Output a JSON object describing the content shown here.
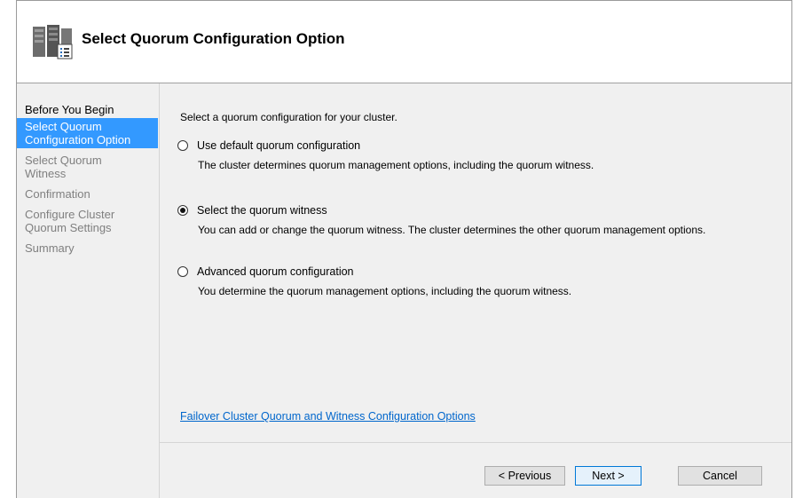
{
  "header": {
    "title": "Select Quorum Configuration Option"
  },
  "sidebar": {
    "steps": [
      {
        "label": "Before You Begin"
      },
      {
        "label": "Select Quorum Configuration Option"
      },
      {
        "label": "Select Quorum Witness"
      },
      {
        "label": "Confirmation"
      },
      {
        "label": "Configure Cluster Quorum Settings"
      },
      {
        "label": "Summary"
      }
    ]
  },
  "main": {
    "intro": "Select a quorum configuration for your cluster.",
    "options": [
      {
        "label": "Use default quorum configuration",
        "description": "The cluster determines quorum management options, including the quorum witness.",
        "checked": false
      },
      {
        "label": "Select the quorum witness",
        "description": "You can add or change the quorum witness. The cluster determines the other quorum management options.",
        "checked": true
      },
      {
        "label": "Advanced quorum configuration",
        "description": "You determine the quorum management options, including the quorum witness.",
        "checked": false
      }
    ],
    "help_link": "Failover Cluster Quorum and Witness Configuration Options"
  },
  "footer": {
    "previous_label": "< Previous",
    "next_label": "Next >",
    "cancel_label": "Cancel"
  },
  "colors": {
    "accent": "#3399ff",
    "link": "#0066cc",
    "panel": "#f0f0f0"
  },
  "icons": {
    "header": "server-cluster-icon"
  }
}
